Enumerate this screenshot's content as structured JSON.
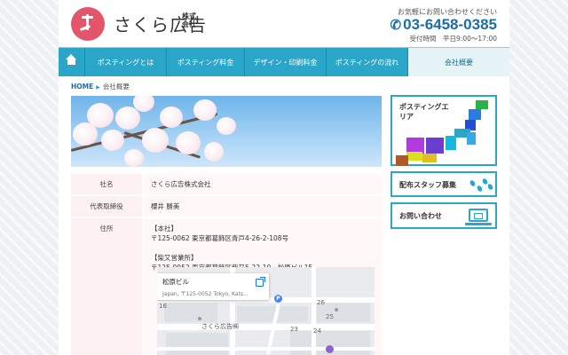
{
  "header": {
    "logo_text": "さくら広告",
    "logo_sub": "株式会社",
    "contact_note": "お気軽にお問い合わせください",
    "phone": "03-6458-0385",
    "hours": "受付時間　平日9:00～17:00"
  },
  "nav": {
    "items": [
      {
        "label": "ポスティングとは"
      },
      {
        "label": "ポスティング料金"
      },
      {
        "label": "デザイン・印刷料金"
      },
      {
        "label": "ポスティングの流れ"
      },
      {
        "label": "会社概要"
      }
    ]
  },
  "breadcrumb": {
    "home": "HOME",
    "current": "会社概要"
  },
  "company": {
    "name_label": "社名",
    "name_value": "さくら広告株式会社",
    "rep_label": "代表取締役",
    "rep_value": "櫻井 勝美",
    "address_label": "住所",
    "head_office_title": "【本社】",
    "head_office_address": "〒125-0062 東京都葛飾区青戸4-26-2-108号",
    "branch_title": "【柴又営業所】",
    "branch_address": "〒125-0052 東京都葛飾区柴又5-22-10　松原ビル1F"
  },
  "map": {
    "card_title": "松原ビル",
    "card_address": "Japan, 〒125-0052 Tokyo, Kats...",
    "place_label": "さくら広告㈱",
    "numbers": [
      "16",
      "26",
      "25",
      "24",
      "23"
    ],
    "parking_glyph": "P"
  },
  "sidebar": {
    "area_label": "ポスティングエリア",
    "staff_label": "配布スタッフ募集",
    "contact_label": "お問い合わせ"
  },
  "colors": {
    "accent": "#2aa6c9",
    "brand_pink": "#e2556a",
    "phone_blue": "#1a6ea8"
  }
}
